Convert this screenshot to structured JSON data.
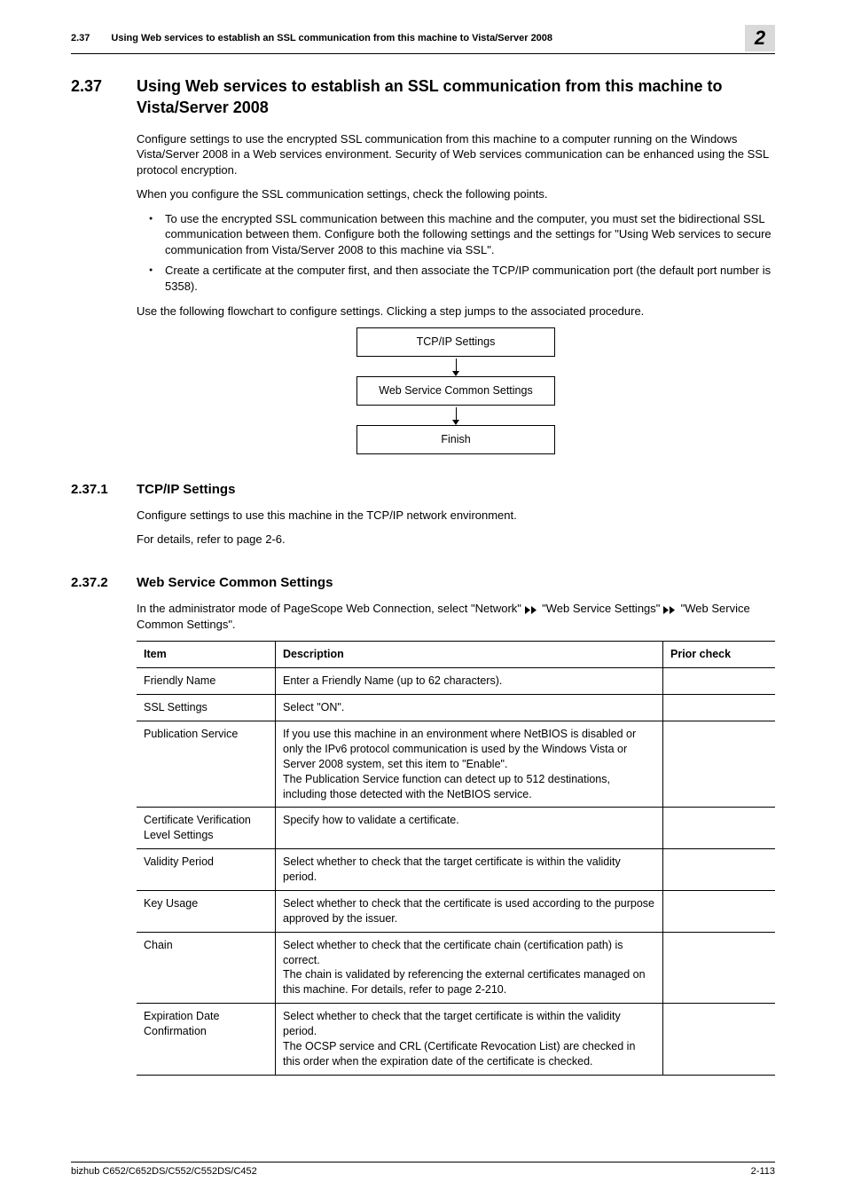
{
  "header": {
    "section_no": "2.37",
    "running_title": "Using Web services to establish an SSL communication from this machine to Vista/Server 2008",
    "chapter": "2"
  },
  "section": {
    "number": "2.37",
    "title": "Using Web services to establish an SSL communication from this machine to Vista/Server 2008"
  },
  "intro": {
    "p1": "Configure settings to use the encrypted SSL communication from this machine to a computer running on the Windows Vista/Server 2008 in a Web services environment. Security of Web services communication can be enhanced using the SSL protocol encryption.",
    "p2": "When you configure the SSL communication settings, check the following points.",
    "bul1": "To use the encrypted SSL communication between this machine and the computer, you must set the bidirectional SSL communication between them. Configure both the following settings and the settings for \"Using Web services to secure communication from Vista/Server 2008 to this machine via SSL\".",
    "bul2": "Create a certificate at the computer first, and then associate the TCP/IP communication port (the default port number is 5358).",
    "p3": "Use the following flowchart to configure settings. Clicking a step jumps to the associated procedure."
  },
  "flow": {
    "b1": "TCP/IP Settings",
    "b2": "Web Service Common Settings",
    "b3": "Finish"
  },
  "sub1": {
    "number": "2.37.1",
    "title": "TCP/IP Settings",
    "p1": "Configure settings to use this machine in the TCP/IP network environment.",
    "p2": "For details, refer to page 2-6."
  },
  "sub2": {
    "number": "2.37.2",
    "title": "Web Service Common Settings",
    "p1a": "In the administrator mode of PageScope Web Connection, select \"Network\" ",
    "p1b": " \"Web Service Settings\" ",
    "p1c": " \"Web Service Common Settings\"."
  },
  "table": {
    "h1": "Item",
    "h2": "Description",
    "h3": "Prior check",
    "rows": [
      {
        "item": "Friendly Name",
        "desc": "Enter a Friendly Name (up to 62 characters).",
        "prior": ""
      },
      {
        "item": "SSL Settings",
        "desc": "Select \"ON\".",
        "prior": ""
      },
      {
        "item": "Publication Service",
        "desc": "If you use this machine in an environment where NetBIOS is disabled or only the IPv6 protocol communication is used by the Windows Vista or Server 2008 system, set this item to \"Enable\".\nThe Publication Service function can detect up to 512 destinations, including those detected with the NetBIOS service.",
        "prior": ""
      },
      {
        "item": "Certificate Verification Level Settings",
        "desc": "Specify how to validate a certificate.",
        "prior": ""
      },
      {
        "item": "Validity Period",
        "desc": "Select whether to check that the target certificate is within the validity period.",
        "prior": ""
      },
      {
        "item": "Key Usage",
        "desc": "Select whether to check that the certificate is used according to the purpose approved by the issuer.",
        "prior": ""
      },
      {
        "item": "Chain",
        "desc": "Select whether to check that the certificate chain (certification path) is correct.\nThe chain is validated by referencing the external certificates managed on this machine. For details, refer to page 2-210.",
        "prior": ""
      },
      {
        "item": "Expiration Date Confirmation",
        "desc": "Select whether to check that the target certificate is within the validity period.\nThe OCSP service and CRL (Certificate Revocation List) are checked in this order when the expiration date of the certificate is checked.",
        "prior": ""
      }
    ]
  },
  "footer": {
    "left": "bizhub C652/C652DS/C552/C552DS/C452",
    "right": "2-113"
  }
}
